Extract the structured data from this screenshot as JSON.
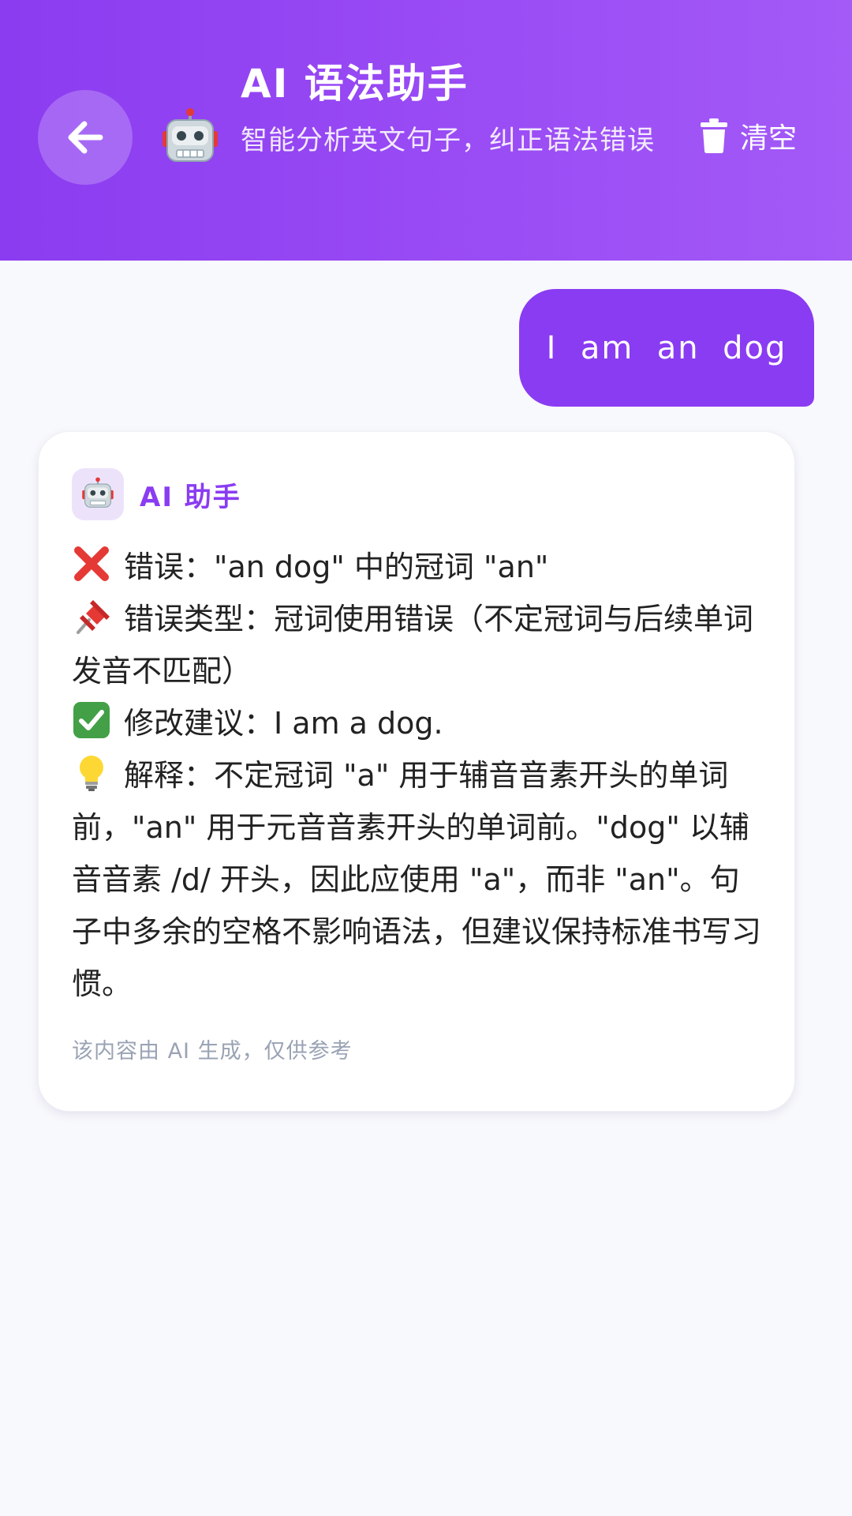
{
  "header": {
    "title": "AI 语法助手",
    "subtitle": "智能分析英文句子，纠正语法错误",
    "clear_label": "清空",
    "back_icon": "arrow-left-icon",
    "avatar_icon": "robot-icon",
    "clear_icon": "trash-icon"
  },
  "chat": {
    "user_message": "I  am  an  dog",
    "ai": {
      "name": "AI 助手",
      "lines": [
        {
          "icon": "cross-mark-icon",
          "text": "错误：\"an dog\" 中的冠词 \"an\""
        },
        {
          "icon": "pushpin-icon",
          "text": "错误类型：冠词使用错误（不定冠词与后续单词发音不匹配）"
        },
        {
          "icon": "check-mark-icon",
          "text": "修改建议：I am a dog."
        },
        {
          "icon": "light-bulb-icon",
          "text": "解释：不定冠词 \"a\" 用于辅音音素开头的单词前，\"an\" 用于元音音素开头的单词前。\"dog\" 以辅音音素 /d/ 开头，因此应使用 \"a\"，而非 \"an\"。句子中多余的空格不影响语法，但建议保持标准书写习惯。"
        }
      ],
      "disclaimer": "该内容由 AI 生成，仅供参考"
    }
  },
  "colors": {
    "header_gradient_start": "#8b3cf0",
    "header_gradient_end": "#a35af7",
    "accent": "#8a3cf2",
    "background": "#f8f9fc"
  }
}
